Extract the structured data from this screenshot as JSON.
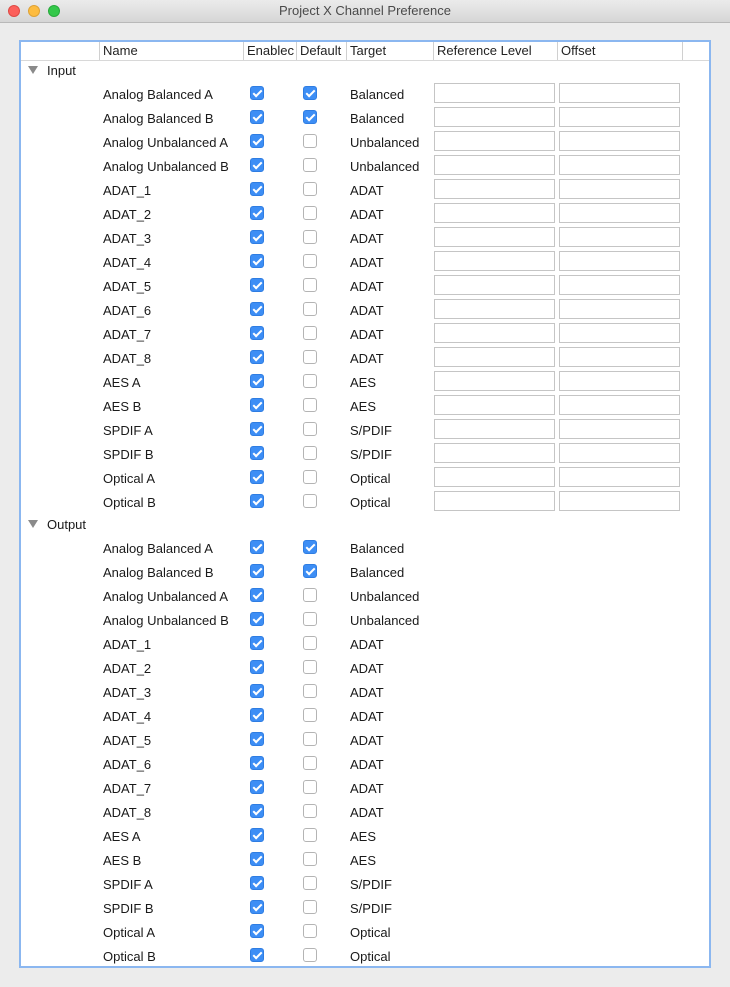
{
  "window": {
    "title": "Project X Channel Preference"
  },
  "columns": [
    "Name",
    "Enablec",
    "Default",
    "Target",
    "Reference Level",
    "Offset"
  ],
  "groups": [
    {
      "label": "Input",
      "has_fields": true,
      "rows": [
        {
          "name": "Analog Balanced A",
          "enabled": true,
          "default": true,
          "target": "Balanced",
          "reference_level": "",
          "offset": ""
        },
        {
          "name": "Analog Balanced B",
          "enabled": true,
          "default": true,
          "target": "Balanced",
          "reference_level": "",
          "offset": ""
        },
        {
          "name": "Analog Unbalanced A",
          "enabled": true,
          "default": false,
          "target": "Unbalanced",
          "reference_level": "",
          "offset": ""
        },
        {
          "name": "Analog Unbalanced B",
          "enabled": true,
          "default": false,
          "target": "Unbalanced",
          "reference_level": "",
          "offset": ""
        },
        {
          "name": "ADAT_1",
          "enabled": true,
          "default": false,
          "target": "ADAT",
          "reference_level": "",
          "offset": ""
        },
        {
          "name": "ADAT_2",
          "enabled": true,
          "default": false,
          "target": "ADAT",
          "reference_level": "",
          "offset": ""
        },
        {
          "name": "ADAT_3",
          "enabled": true,
          "default": false,
          "target": "ADAT",
          "reference_level": "",
          "offset": ""
        },
        {
          "name": "ADAT_4",
          "enabled": true,
          "default": false,
          "target": "ADAT",
          "reference_level": "",
          "offset": ""
        },
        {
          "name": "ADAT_5",
          "enabled": true,
          "default": false,
          "target": "ADAT",
          "reference_level": "",
          "offset": ""
        },
        {
          "name": "ADAT_6",
          "enabled": true,
          "default": false,
          "target": "ADAT",
          "reference_level": "",
          "offset": ""
        },
        {
          "name": "ADAT_7",
          "enabled": true,
          "default": false,
          "target": "ADAT",
          "reference_level": "",
          "offset": ""
        },
        {
          "name": "ADAT_8",
          "enabled": true,
          "default": false,
          "target": "ADAT",
          "reference_level": "",
          "offset": ""
        },
        {
          "name": "AES A",
          "enabled": true,
          "default": false,
          "target": "AES",
          "reference_level": "",
          "offset": ""
        },
        {
          "name": "AES B",
          "enabled": true,
          "default": false,
          "target": "AES",
          "reference_level": "",
          "offset": ""
        },
        {
          "name": "SPDIF A",
          "enabled": true,
          "default": false,
          "target": "S/PDIF",
          "reference_level": "",
          "offset": ""
        },
        {
          "name": "SPDIF B",
          "enabled": true,
          "default": false,
          "target": "S/PDIF",
          "reference_level": "",
          "offset": ""
        },
        {
          "name": "Optical A",
          "enabled": true,
          "default": false,
          "target": "Optical",
          "reference_level": "",
          "offset": ""
        },
        {
          "name": "Optical B",
          "enabled": true,
          "default": false,
          "target": "Optical",
          "reference_level": "",
          "offset": ""
        }
      ]
    },
    {
      "label": "Output",
      "has_fields": false,
      "rows": [
        {
          "name": "Analog Balanced A",
          "enabled": true,
          "default": true,
          "target": "Balanced"
        },
        {
          "name": "Analog Balanced B",
          "enabled": true,
          "default": true,
          "target": "Balanced"
        },
        {
          "name": "Analog Unbalanced A",
          "enabled": true,
          "default": false,
          "target": "Unbalanced"
        },
        {
          "name": "Analog Unbalanced B",
          "enabled": true,
          "default": false,
          "target": "Unbalanced"
        },
        {
          "name": "ADAT_1",
          "enabled": true,
          "default": false,
          "target": "ADAT"
        },
        {
          "name": "ADAT_2",
          "enabled": true,
          "default": false,
          "target": "ADAT"
        },
        {
          "name": "ADAT_3",
          "enabled": true,
          "default": false,
          "target": "ADAT"
        },
        {
          "name": "ADAT_4",
          "enabled": true,
          "default": false,
          "target": "ADAT"
        },
        {
          "name": "ADAT_5",
          "enabled": true,
          "default": false,
          "target": "ADAT"
        },
        {
          "name": "ADAT_6",
          "enabled": true,
          "default": false,
          "target": "ADAT"
        },
        {
          "name": "ADAT_7",
          "enabled": true,
          "default": false,
          "target": "ADAT"
        },
        {
          "name": "ADAT_8",
          "enabled": true,
          "default": false,
          "target": "ADAT"
        },
        {
          "name": "AES A",
          "enabled": true,
          "default": false,
          "target": "AES"
        },
        {
          "name": "AES B",
          "enabled": true,
          "default": false,
          "target": "AES"
        },
        {
          "name": "SPDIF A",
          "enabled": true,
          "default": false,
          "target": "S/PDIF"
        },
        {
          "name": "SPDIF B",
          "enabled": true,
          "default": false,
          "target": "S/PDIF"
        },
        {
          "name": "Optical A",
          "enabled": true,
          "default": false,
          "target": "Optical"
        },
        {
          "name": "Optical B",
          "enabled": true,
          "default": false,
          "target": "Optical"
        }
      ]
    }
  ]
}
